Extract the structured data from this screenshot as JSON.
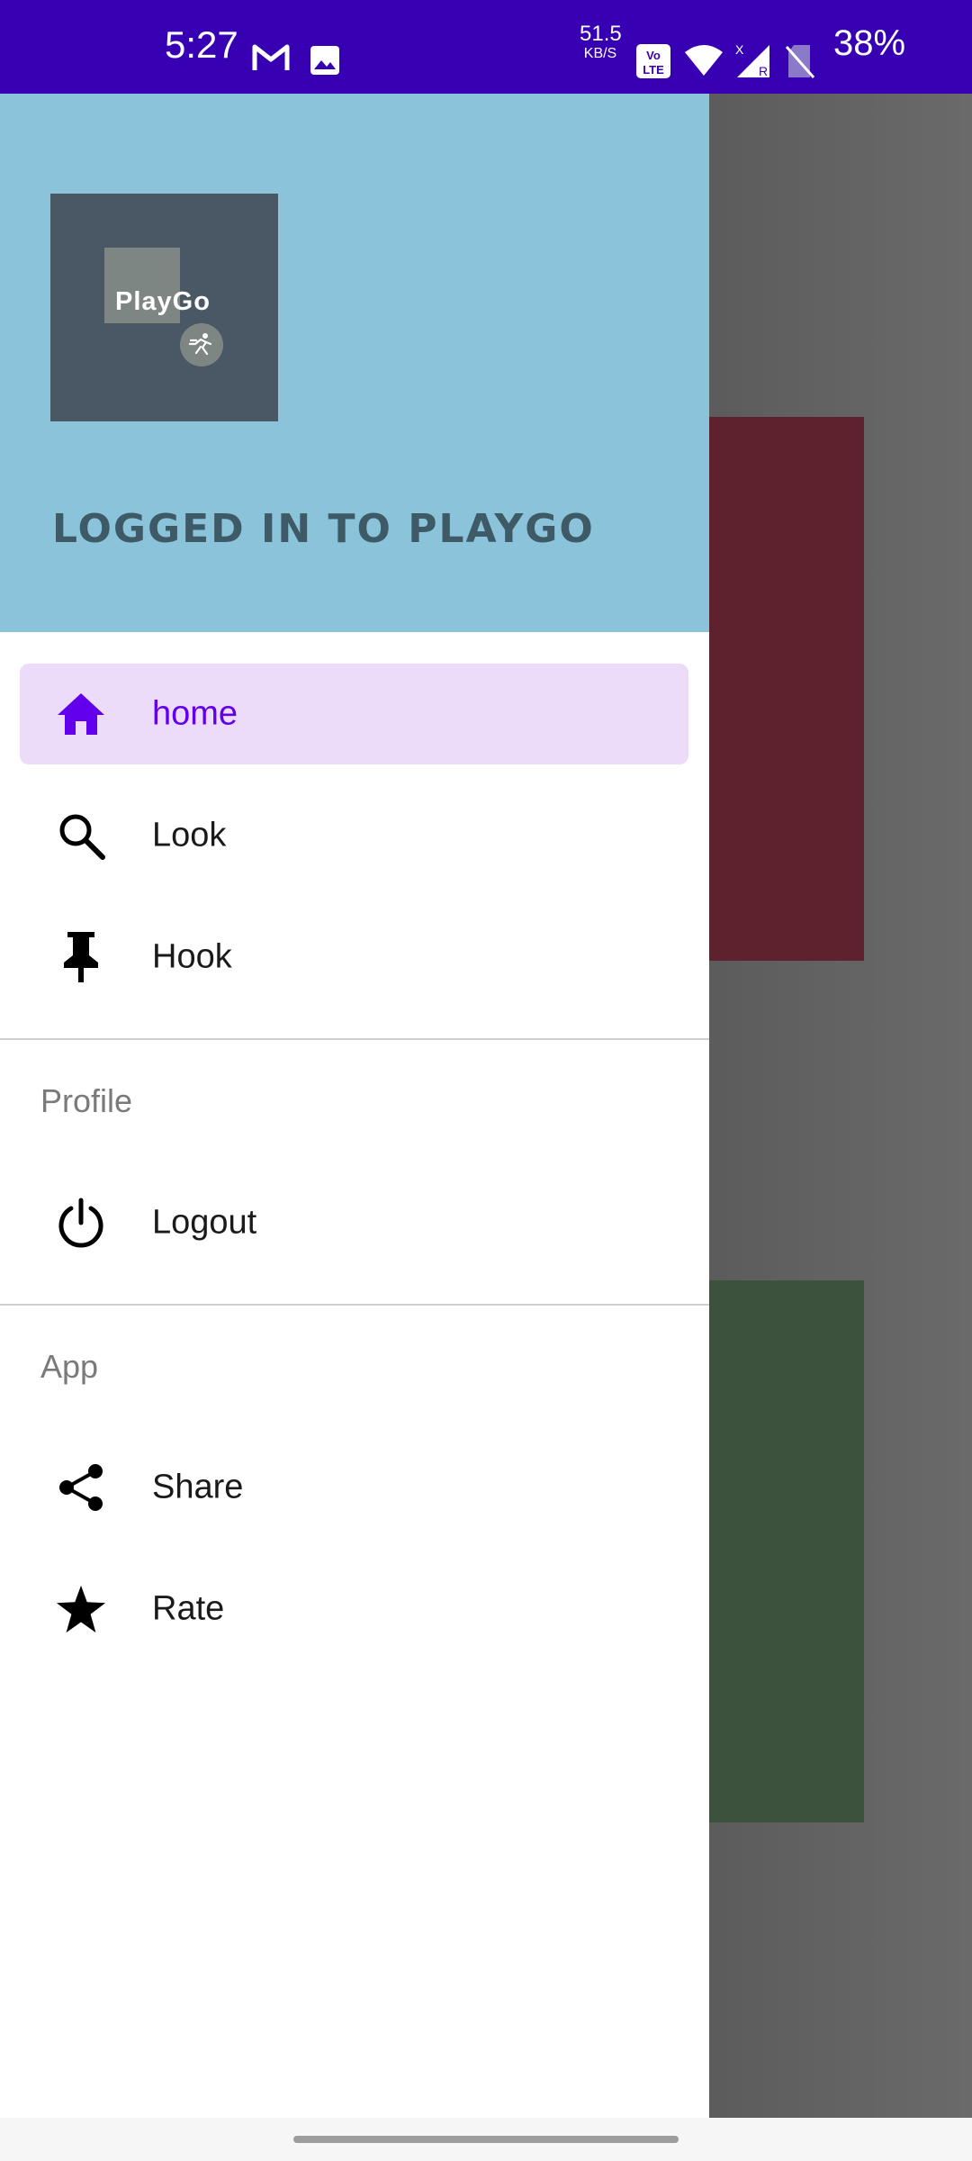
{
  "status_bar": {
    "time": "5:27",
    "net_speed_value": "51.5",
    "net_speed_unit": "KB/S",
    "battery": "38%",
    "icons": [
      "gmail-icon",
      "image-icon",
      "volte-icon",
      "wifi-icon",
      "signal-icon",
      "no-sim-icon"
    ]
  },
  "drawer": {
    "header": {
      "logo_text": "PlayGo",
      "title": "LOGGED IN TO PLAYGO",
      "background": "#8bc4da"
    },
    "primary_items": [
      {
        "label": "home",
        "icon": "home-icon",
        "active": true
      },
      {
        "label": "Look",
        "icon": "search-icon",
        "active": false
      },
      {
        "label": "Hook",
        "icon": "pin-icon",
        "active": false
      }
    ],
    "profile_section": {
      "title": "Profile",
      "items": [
        {
          "label": "Logout",
          "icon": "power-icon"
        }
      ]
    },
    "app_section": {
      "title": "App",
      "items": [
        {
          "label": "Share",
          "icon": "share-icon"
        },
        {
          "label": "Rate",
          "icon": "star-icon"
        }
      ]
    }
  },
  "colors": {
    "status_bar": "#3700b3",
    "accent": "#6200ee",
    "active_item_bg": "#ecdcf9"
  }
}
